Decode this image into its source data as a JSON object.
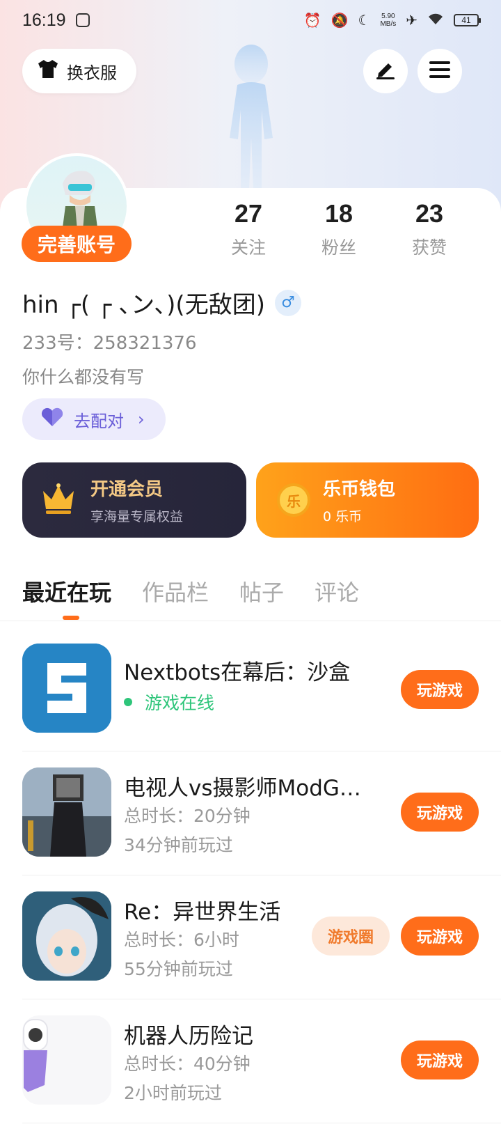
{
  "status_bar": {
    "time": "16:19",
    "net_speed_value": "5.90",
    "net_speed_unit": "MB/s",
    "battery": "41"
  },
  "header": {
    "wardrobe_label": "换衣服",
    "edit_icon": "pen-icon",
    "menu_icon": "menu-icon"
  },
  "profile": {
    "complete_label": "完善账号",
    "nickname": "hin ┌( ┌ ､ン､)(无敌团)",
    "gender": "♂",
    "uid": "233号：258321376",
    "bio": "你什么都没有写",
    "match_label": "去配对"
  },
  "stats": [
    {
      "value": "27",
      "label": "关注"
    },
    {
      "value": "18",
      "label": "粉丝"
    },
    {
      "value": "23",
      "label": "获赞"
    }
  ],
  "vip": {
    "title": "开通会员",
    "subtitle": "享海量专属权益"
  },
  "wallet": {
    "title": "乐币钱包",
    "subtitle": "0 乐币",
    "coin_glyph": "乐"
  },
  "tabs": [
    "最近在玩",
    "作品栏",
    "帖子",
    "评论"
  ],
  "games": [
    {
      "title": "Nextbots在幕后：沙盒",
      "status": "游戏在线",
      "play": "玩游戏"
    },
    {
      "title": "电视人vs摄影师ModG…",
      "duration": "总时长：20分钟",
      "last_played": "34分钟前玩过",
      "play": "玩游戏"
    },
    {
      "title": "Re：异世界生活",
      "duration": "总时长：6小时",
      "last_played": "55分钟前玩过",
      "circle": "游戏圈",
      "play": "玩游戏"
    },
    {
      "title": "机器人历险记",
      "duration": "总时长：40分钟",
      "last_played": "2小时前玩过",
      "play": "玩游戏"
    }
  ],
  "colors": {
    "accent": "#ff6d1a",
    "online": "#2ec57a",
    "match": "#6a5ed8"
  }
}
